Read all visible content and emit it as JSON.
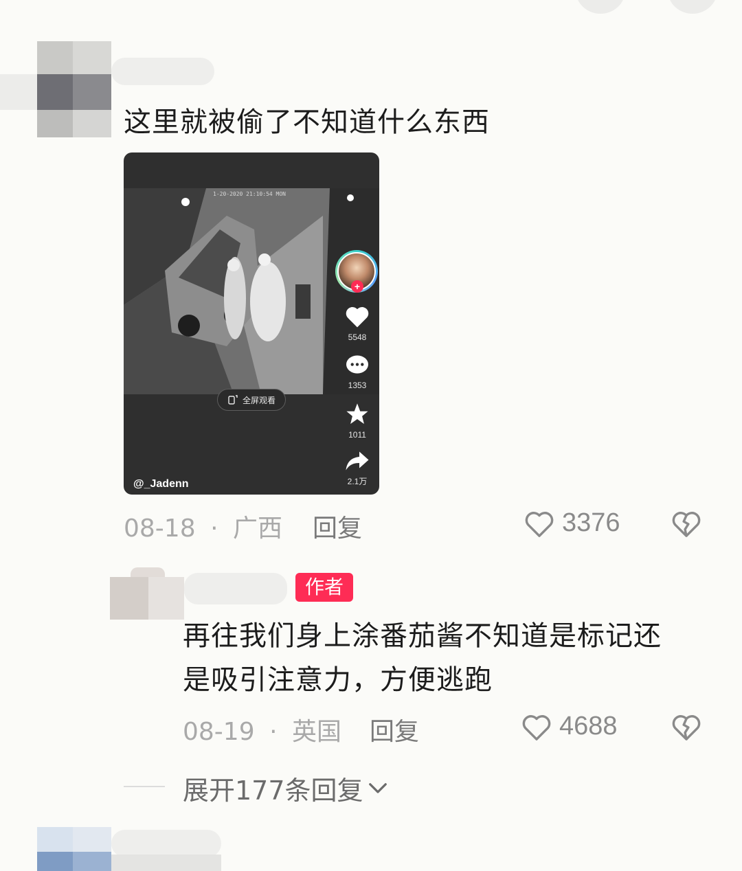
{
  "comment1": {
    "text": "这里就被偷了不知道什么东西",
    "date": "08-18",
    "separator": "·",
    "location": "广西",
    "reply_label": "回复",
    "likes": "3376"
  },
  "video": {
    "author_handle": "@_Jadenn",
    "camera_timestamp": "1-20-2020 21:10:54 MON",
    "fullscreen_label": "全屏观看",
    "like_count": "5548",
    "comment_count": "1353",
    "favorite_count": "1011",
    "share_count": "2.1万",
    "follow_plus": "+"
  },
  "reply1": {
    "author_badge": "作者",
    "text_line1": "再往我们身上涂番茄酱不知道是标记还",
    "text_line2": "是吸引注意力，方便逃跑",
    "date": "08-19",
    "separator": "·",
    "location": "英国",
    "reply_label": "回复",
    "likes": "4688"
  },
  "expand_replies": {
    "label": "展开177条回复",
    "icon": "chevron-down-icon"
  },
  "colors": {
    "accent": "#fe2c55",
    "muted_text": "#a9a9a9",
    "video_bg": "#2f2f2f"
  }
}
